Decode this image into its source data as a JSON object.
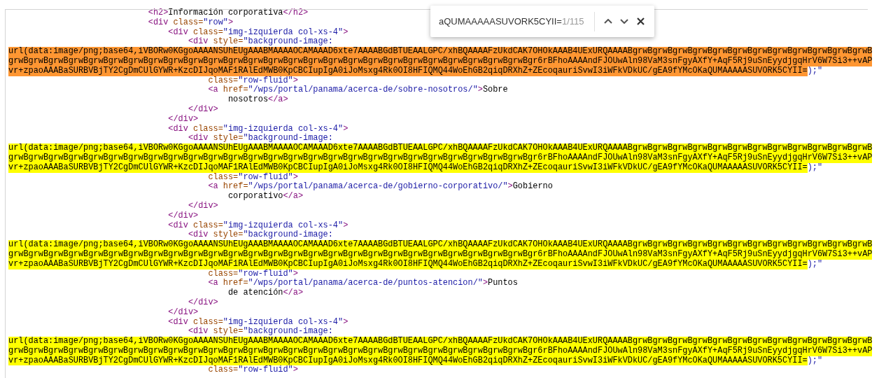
{
  "source_lines": [
    {
      "tokens": [
        {
          "kind": "tag",
          "text": "                            <h2>"
        },
        {
          "kind": "text",
          "text": "Información corporativa"
        },
        {
          "kind": "tag",
          "text": "</h2>"
        }
      ]
    },
    {
      "tokens": [
        {
          "kind": "tag",
          "text": "                            <div "
        },
        {
          "kind": "attr",
          "text": "class="
        },
        {
          "kind": "value",
          "text": "\"row\""
        },
        {
          "kind": "tag",
          "text": ">"
        }
      ]
    },
    {
      "tokens": [
        {
          "kind": "tag",
          "text": "                                <div "
        },
        {
          "kind": "attr",
          "text": "class="
        },
        {
          "kind": "value",
          "text": "\"img-izquierda col-xs-4\""
        },
        {
          "kind": "tag",
          "text": ">"
        }
      ]
    },
    {
      "tokens": [
        {
          "kind": "tag",
          "text": "                                    <div "
        },
        {
          "kind": "attr",
          "text": "style="
        },
        {
          "kind": "value",
          "text": "\"background-image:"
        }
      ]
    },
    {
      "tokens": [
        {
          "kind": "match",
          "selected": true,
          "text": "url(data:image/png;base64,iVBORw0KGgoAAAANSUhEUgAAABMAAAAOCAMAAAD6xte7AAAABGdBTUEAALGPC/xhBQAAAAFzUkdCAK7OHOkAAAB4UExURQAAAABgrwBgrwBgrwBgrwBgrwBgrwBgrwBgrwBgrwBgrwBgrwBgrwB"
        }
      ]
    },
    {
      "tokens": [
        {
          "kind": "match",
          "selected": true,
          "text": "grwBgrwBgrwBgrwBgrwBgrwBgrwBgrwBgrwBgrwBgrwBgrwBgrwBgrwBgrwBgrwBgrwBgrwBgrwBgrwBgrwBgrwBgrwBgrwBgrwBgrwBgr6rBFhoAAAAndFJOUwAln98VaM3snFgyAXfY+AqF5Rj9uSnEyydjgqHrV6W7Si3++vAP"
        }
      ]
    },
    {
      "tokens": [
        {
          "kind": "match",
          "selected": true,
          "text": "vr+zpaoAAABaSURBVBjTY2CgDmCUlGYWR+KzcDIJqoMAF1RAlEdMWB0KpCBCIupIgA0iJoMsxg4Rk0OI8HFIQMQ44WoEhGB2qiqDRXhZ+ZEcoqauriSvwI3iWFkVDkUC/gEA9fYMcOKaQUMAAAAASUVORK5CYII="
        },
        {
          "kind": "value",
          "text": ");\""
        }
      ]
    },
    {
      "tokens": [
        {
          "kind": "attr",
          "text": "                                        class="
        },
        {
          "kind": "value",
          "text": "\"row-fluid\""
        },
        {
          "kind": "tag",
          "text": ">"
        }
      ]
    },
    {
      "tokens": [
        {
          "kind": "tag",
          "text": "                                        <a "
        },
        {
          "kind": "attr",
          "text": "href="
        },
        {
          "kind": "value",
          "text": "\"/wps/portal/panama/acerca-de/sobre-nosotros/\""
        },
        {
          "kind": "tag",
          "text": ">"
        },
        {
          "kind": "text",
          "text": "Sobre"
        }
      ]
    },
    {
      "tokens": [
        {
          "kind": "text",
          "text": "                                            nosotros"
        },
        {
          "kind": "tag",
          "text": "</a>"
        }
      ]
    },
    {
      "tokens": [
        {
          "kind": "tag",
          "text": "                                    </div>"
        }
      ]
    },
    {
      "tokens": [
        {
          "kind": "tag",
          "text": "                                </div>"
        }
      ]
    },
    {
      "tokens": [
        {
          "kind": "tag",
          "text": "                                <div "
        },
        {
          "kind": "attr",
          "text": "class="
        },
        {
          "kind": "value",
          "text": "\"img-izquierda col-xs-4\""
        },
        {
          "kind": "tag",
          "text": ">"
        }
      ]
    },
    {
      "tokens": [
        {
          "kind": "tag",
          "text": "                                    <div "
        },
        {
          "kind": "attr",
          "text": "style="
        },
        {
          "kind": "value",
          "text": "\"background-image:"
        }
      ]
    },
    {
      "tokens": [
        {
          "kind": "match",
          "selected": false,
          "text": "url(data:image/png;base64,iVBORw0KGgoAAAANSUhEUgAAABMAAAAOCAMAAAD6xte7AAAABGdBTUEAALGPC/xhBQAAAAFzUkdCAK7OHOkAAAB4UExURQAAAABgrwBgrwBgrwBgrwBgrwBgrwBgrwBgrwBgrwBgrwBgrwBgrwB"
        }
      ]
    },
    {
      "tokens": [
        {
          "kind": "match",
          "selected": false,
          "text": "grwBgrwBgrwBgrwBgrwBgrwBgrwBgrwBgrwBgrwBgrwBgrwBgrwBgrwBgrwBgrwBgrwBgrwBgrwBgrwBgrwBgrwBgrwBgrwBgrwBgrwBgr6rBFhoAAAAndFJOUwAln98VaM3snFgyAXfY+AqF5Rj9uSnEyydjgqHrV6W7Si3++vAP"
        }
      ]
    },
    {
      "tokens": [
        {
          "kind": "match",
          "selected": false,
          "text": "vr+zpaoAAABaSURBVBjTY2CgDmCUlGYWR+KzcDIJqoMAF1RAlEdMWB0KpCBCIupIgA0iJoMsxg4Rk0OI8HFIQMQ44WoEhGB2qiqDRXhZ+ZEcoqauriSvwI3iWFkVDkUC/gEA9fYMcOKaQUMAAAAASUVORK5CYII="
        },
        {
          "kind": "value",
          "text": ");\""
        }
      ]
    },
    {
      "tokens": [
        {
          "kind": "attr",
          "text": "                                        class="
        },
        {
          "kind": "value",
          "text": "\"row-fluid\""
        },
        {
          "kind": "tag",
          "text": ">"
        }
      ]
    },
    {
      "tokens": [
        {
          "kind": "tag",
          "text": "                                        <a "
        },
        {
          "kind": "attr",
          "text": "href="
        },
        {
          "kind": "value",
          "text": "\"/wps/portal/panama/acerca-de/gobierno-corporativo/\""
        },
        {
          "kind": "tag",
          "text": ">"
        },
        {
          "kind": "text",
          "text": "Gobierno"
        }
      ]
    },
    {
      "tokens": [
        {
          "kind": "text",
          "text": "                                            corporativo"
        },
        {
          "kind": "tag",
          "text": "</a>"
        }
      ]
    },
    {
      "tokens": [
        {
          "kind": "tag",
          "text": "                                    </div>"
        }
      ]
    },
    {
      "tokens": [
        {
          "kind": "tag",
          "text": "                                </div>"
        }
      ]
    },
    {
      "tokens": [
        {
          "kind": "tag",
          "text": "                                <div "
        },
        {
          "kind": "attr",
          "text": "class="
        },
        {
          "kind": "value",
          "text": "\"img-izquierda col-xs-4\""
        },
        {
          "kind": "tag",
          "text": ">"
        }
      ]
    },
    {
      "tokens": [
        {
          "kind": "tag",
          "text": "                                    <div "
        },
        {
          "kind": "attr",
          "text": "style="
        },
        {
          "kind": "value",
          "text": "\"background-image:"
        }
      ]
    },
    {
      "tokens": [
        {
          "kind": "match",
          "selected": false,
          "text": "url(data:image/png;base64,iVBORw0KGgoAAAANSUhEUgAAABMAAAAOCAMAAAD6xte7AAAABGdBTUEAALGPC/xhBQAAAAFzUkdCAK7OHOkAAAB4UExURQAAAABgrwBgrwBgrwBgrwBgrwBgrwBgrwBgrwBgrwBgrwBgrwBgrwB"
        }
      ]
    },
    {
      "tokens": [
        {
          "kind": "match",
          "selected": false,
          "text": "grwBgrwBgrwBgrwBgrwBgrwBgrwBgrwBgrwBgrwBgrwBgrwBgrwBgrwBgrwBgrwBgrwBgrwBgrwBgrwBgrwBgrwBgrwBgrwBgrwBgrwBgr6rBFhoAAAAndFJOUwAln98VaM3snFgyAXfY+AqF5Rj9uSnEyydjgqHrV6W7Si3++vAP"
        }
      ]
    },
    {
      "tokens": [
        {
          "kind": "match",
          "selected": false,
          "text": "vr+zpaoAAABaSURBVBjTY2CgDmCUlGYWR+KzcDIJqoMAF1RAlEdMWB0KpCBCIupIgA0iJoMsxg4Rk0OI8HFIQMQ44WoEhGB2qiqDRXhZ+ZEcoqauriSvwI3iWFkVDkUC/gEA9fYMcOKaQUMAAAAASUVORK5CYII="
        },
        {
          "kind": "value",
          "text": ");\""
        }
      ]
    },
    {
      "tokens": [
        {
          "kind": "attr",
          "text": "                                        class="
        },
        {
          "kind": "value",
          "text": "\"row-fluid\""
        },
        {
          "kind": "tag",
          "text": ">"
        }
      ]
    },
    {
      "tokens": [
        {
          "kind": "tag",
          "text": "                                        <a "
        },
        {
          "kind": "attr",
          "text": "href="
        },
        {
          "kind": "value",
          "text": "\"/wps/portal/panama/acerca-de/puntos-atencion/\""
        },
        {
          "kind": "tag",
          "text": ">"
        },
        {
          "kind": "text",
          "text": "Puntos"
        }
      ]
    },
    {
      "tokens": [
        {
          "kind": "text",
          "text": "                                            de atención"
        },
        {
          "kind": "tag",
          "text": "</a>"
        }
      ]
    },
    {
      "tokens": [
        {
          "kind": "tag",
          "text": "                                    </div>"
        }
      ]
    },
    {
      "tokens": [
        {
          "kind": "tag",
          "text": "                                </div>"
        }
      ]
    },
    {
      "tokens": [
        {
          "kind": "tag",
          "text": "                                <div "
        },
        {
          "kind": "attr",
          "text": "class="
        },
        {
          "kind": "value",
          "text": "\"img-izquierda col-xs-4\""
        },
        {
          "kind": "tag",
          "text": ">"
        }
      ]
    },
    {
      "tokens": [
        {
          "kind": "tag",
          "text": "                                    <div "
        },
        {
          "kind": "attr",
          "text": "style="
        },
        {
          "kind": "value",
          "text": "\"background-image:"
        }
      ]
    },
    {
      "tokens": [
        {
          "kind": "match",
          "selected": false,
          "text": "url(data:image/png;base64,iVBORw0KGgoAAAANSUhEUgAAABMAAAAOCAMAAAD6xte7AAAABGdBTUEAALGPC/xhBQAAAAFzUkdCAK7OHOkAAAB4UExURQAAAABgrwBgrwBgrwBgrwBgrwBgrwBgrwBgrwBgrwBgrwBgrwBgrwB"
        }
      ]
    },
    {
      "tokens": [
        {
          "kind": "match",
          "selected": false,
          "text": "grwBgrwBgrwBgrwBgrwBgrwBgrwBgrwBgrwBgrwBgrwBgrwBgrwBgrwBgrwBgrwBgrwBgrwBgrwBgrwBgrwBgrwBgrwBgrwBgrwBgrwBgr6rBFhoAAAAndFJOUwAln98VaM3snFgyAXfY+AqF5Rj9uSnEyydjgqHrV6W7Si3++vAP"
        }
      ]
    },
    {
      "tokens": [
        {
          "kind": "match",
          "selected": false,
          "text": "vr+zpaoAAABaSURBVBjTY2CgDmCUlGYWR+KzcDIJqoMAF1RAlEdMWB0KpCBCIupIgA0iJoMsxg4Rk0OI8HFIQMQ44WoEhGB2qiqDRXhZ+ZEcoqauriSvwI3iWFkVDkUC/gEA9fYMcOKaQUMAAAAASUVORK5CYII="
        },
        {
          "kind": "value",
          "text": ");\""
        }
      ]
    },
    {
      "tokens": [
        {
          "kind": "attr",
          "text": "                                        class="
        },
        {
          "kind": "value",
          "text": "\"row-fluid\""
        },
        {
          "kind": "tag",
          "text": ">"
        }
      ]
    }
  ],
  "find_bar": {
    "query": "aQUMAAAAASUVORK5CYII=",
    "count": "1/115"
  }
}
